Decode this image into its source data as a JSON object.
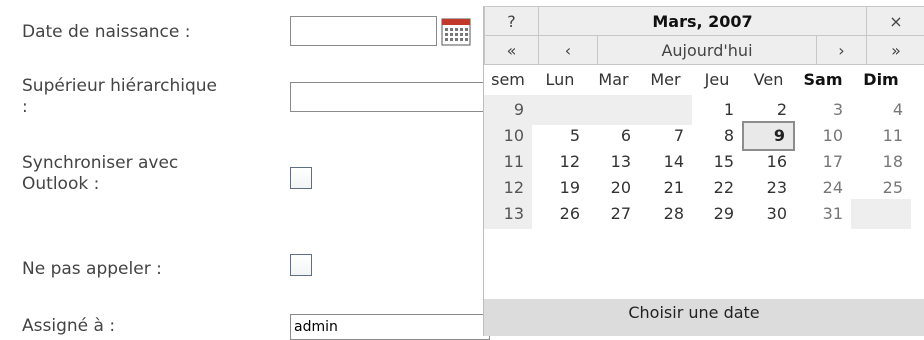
{
  "form": {
    "birthdate_label": "Date de naissance :",
    "birthdate_value": "",
    "supervisor_label_line1": "Supérieur hiérarchique",
    "supervisor_label_line2": ":",
    "supervisor_value": "",
    "sync_label_line1": "Synchroniser avec",
    "sync_label_line2": "Outlook :",
    "sync_checked": false,
    "donotcall_label": "Ne pas appeler :",
    "donotcall_checked": false,
    "assigned_label": "Assigné à :",
    "assigned_value": "admin"
  },
  "calendar": {
    "help": "?",
    "title": "Mars, 2007",
    "close": "×",
    "prev_year": "«",
    "prev_month": "‹",
    "today": "Aujourd'hui",
    "next_month": "›",
    "next_year": "»",
    "days_of_week": [
      "sem",
      "Lun",
      "Mar",
      "Mer",
      "Jeu",
      "Ven",
      "Sam",
      "Dim"
    ],
    "weeks": [
      {
        "week": "9",
        "days": [
          "",
          "",
          "",
          "1",
          "2",
          "3",
          "4"
        ]
      },
      {
        "week": "10",
        "days": [
          "5",
          "6",
          "7",
          "8",
          "9",
          "10",
          "11"
        ]
      },
      {
        "week": "11",
        "days": [
          "12",
          "13",
          "14",
          "15",
          "16",
          "17",
          "18"
        ]
      },
      {
        "week": "12",
        "days": [
          "19",
          "20",
          "21",
          "22",
          "23",
          "24",
          "25"
        ]
      },
      {
        "week": "13",
        "days": [
          "26",
          "27",
          "28",
          "29",
          "30",
          "31",
          ""
        ]
      }
    ],
    "selected_day": "9",
    "footer": "Choisir une date"
  },
  "icons": {
    "calendar_button": "calendar-icon"
  }
}
